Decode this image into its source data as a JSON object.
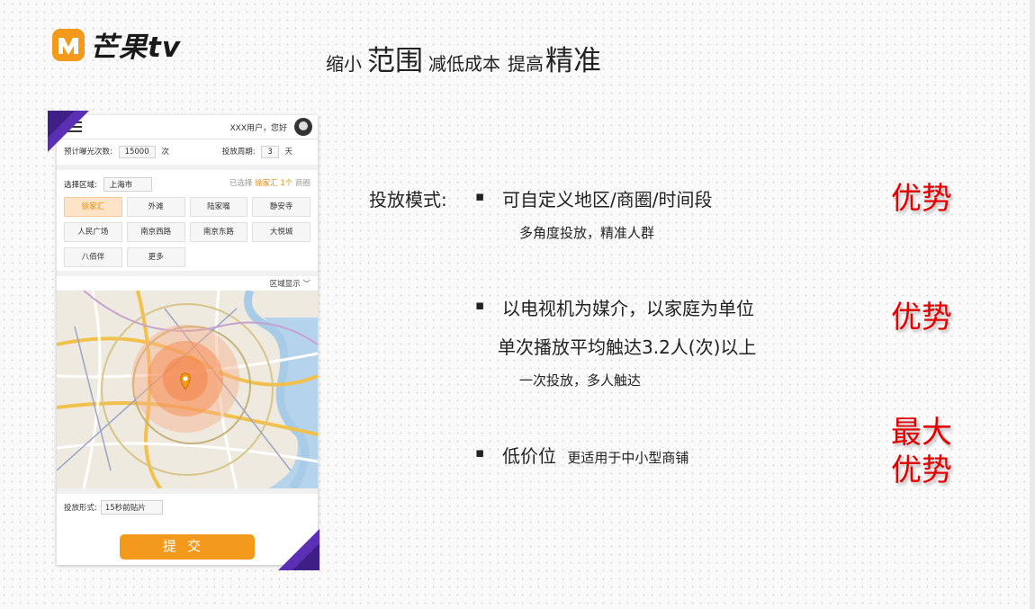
{
  "logo": {
    "text": "芒果tv"
  },
  "headline": {
    "p1": "缩小",
    "p2": "范围",
    "p3": "减低成本",
    "p4": "提高",
    "p5": "精准"
  },
  "phone": {
    "greeting": "XXX用户，您好",
    "exposure_label": "预计曝光次数:",
    "exposure_value": "15000",
    "exposure_unit": "次",
    "period_label": "投放周期:",
    "period_value": "3",
    "period_unit": "天",
    "region_label": "选择区域:",
    "region_value": "上海市",
    "selected_prefix": "已选择",
    "selected_area": "徐家汇",
    "selected_count": "1个",
    "selected_suffix": "商圈",
    "tags": [
      "徐家汇",
      "外滩",
      "陆家嘴",
      "静安寺",
      "人民广场",
      "南京西路",
      "南京东路",
      "大悦城",
      "八佰伴",
      "更多"
    ],
    "map_toggle": "区域显示",
    "format_label": "投放形式:",
    "format_value": "15秒前贴片",
    "submit": "提交"
  },
  "content": {
    "mode_label": "投放模式:",
    "b1": "可自定义地区/商圈/时间段",
    "b1_sub": "多角度投放，精准人群",
    "b2_line1": "以电视机为媒介，以家庭为单位",
    "b2_line2": "单次播放平均触达3.2人(次)以上",
    "b2_sub": "一次投放，多人触达",
    "b3": "低价位",
    "b3_sub": "更适用于中小型商铺",
    "adv1": "优势",
    "adv2": "优势",
    "adv3_line1": "最大",
    "adv3_line2": "优势"
  },
  "colors": {
    "accent": "#f39a1c",
    "advantage": "#e50000",
    "corner": "#5a2fb3"
  }
}
